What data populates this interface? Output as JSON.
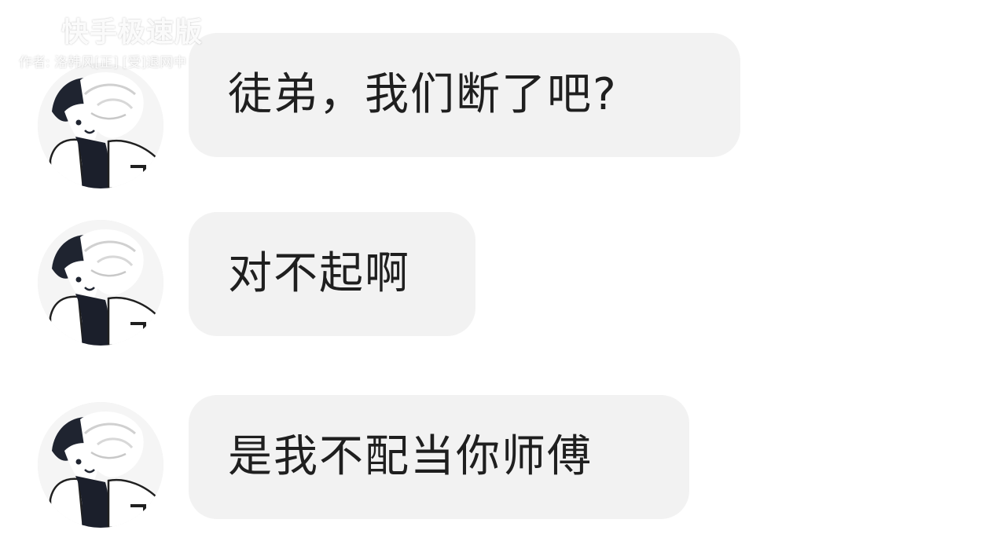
{
  "watermark": {
    "title": "快手极速版",
    "author": "作者: 洛韩风[正] [受]退网中"
  },
  "chat": {
    "messages": [
      {
        "text": "徒弟，我们断了吧?"
      },
      {
        "text": "对不起啊"
      },
      {
        "text": "是我不配当你师傅"
      }
    ]
  },
  "colors": {
    "background": "#ffffff",
    "bubble": "#f2f2f2",
    "text": "#1f1f1f",
    "watermark": "#ffffff"
  }
}
